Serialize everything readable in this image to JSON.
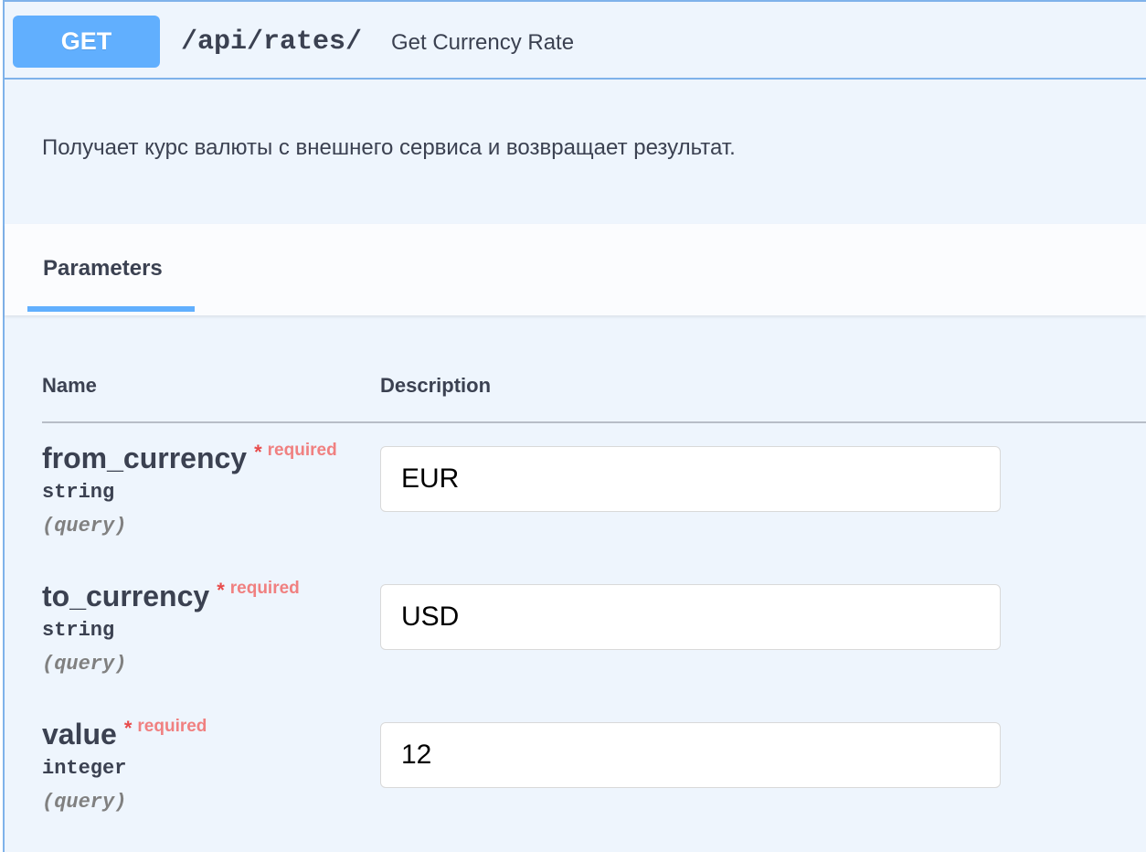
{
  "operation": {
    "method": "GET",
    "path": "/api/rates/",
    "summary": "Get Currency Rate",
    "description": "Получает курс валюты с внешнего сервиса и возвращает результат."
  },
  "tabs": {
    "parameters_label": "Parameters"
  },
  "table": {
    "name_header": "Name",
    "description_header": "Description"
  },
  "parameters": [
    {
      "name": "from_currency",
      "required_mark": "*",
      "required_label": "required",
      "type": "string",
      "in": "(query)",
      "value": "EUR"
    },
    {
      "name": "to_currency",
      "required_mark": "*",
      "required_label": "required",
      "type": "string",
      "in": "(query)",
      "value": "USD"
    },
    {
      "name": "value",
      "required_mark": "*",
      "required_label": "required",
      "type": "integer",
      "in": "(query)",
      "value": "12"
    }
  ],
  "colors": {
    "method_get": "#61affe",
    "block_background": "#eef5fd",
    "required": "#e84b4b"
  }
}
